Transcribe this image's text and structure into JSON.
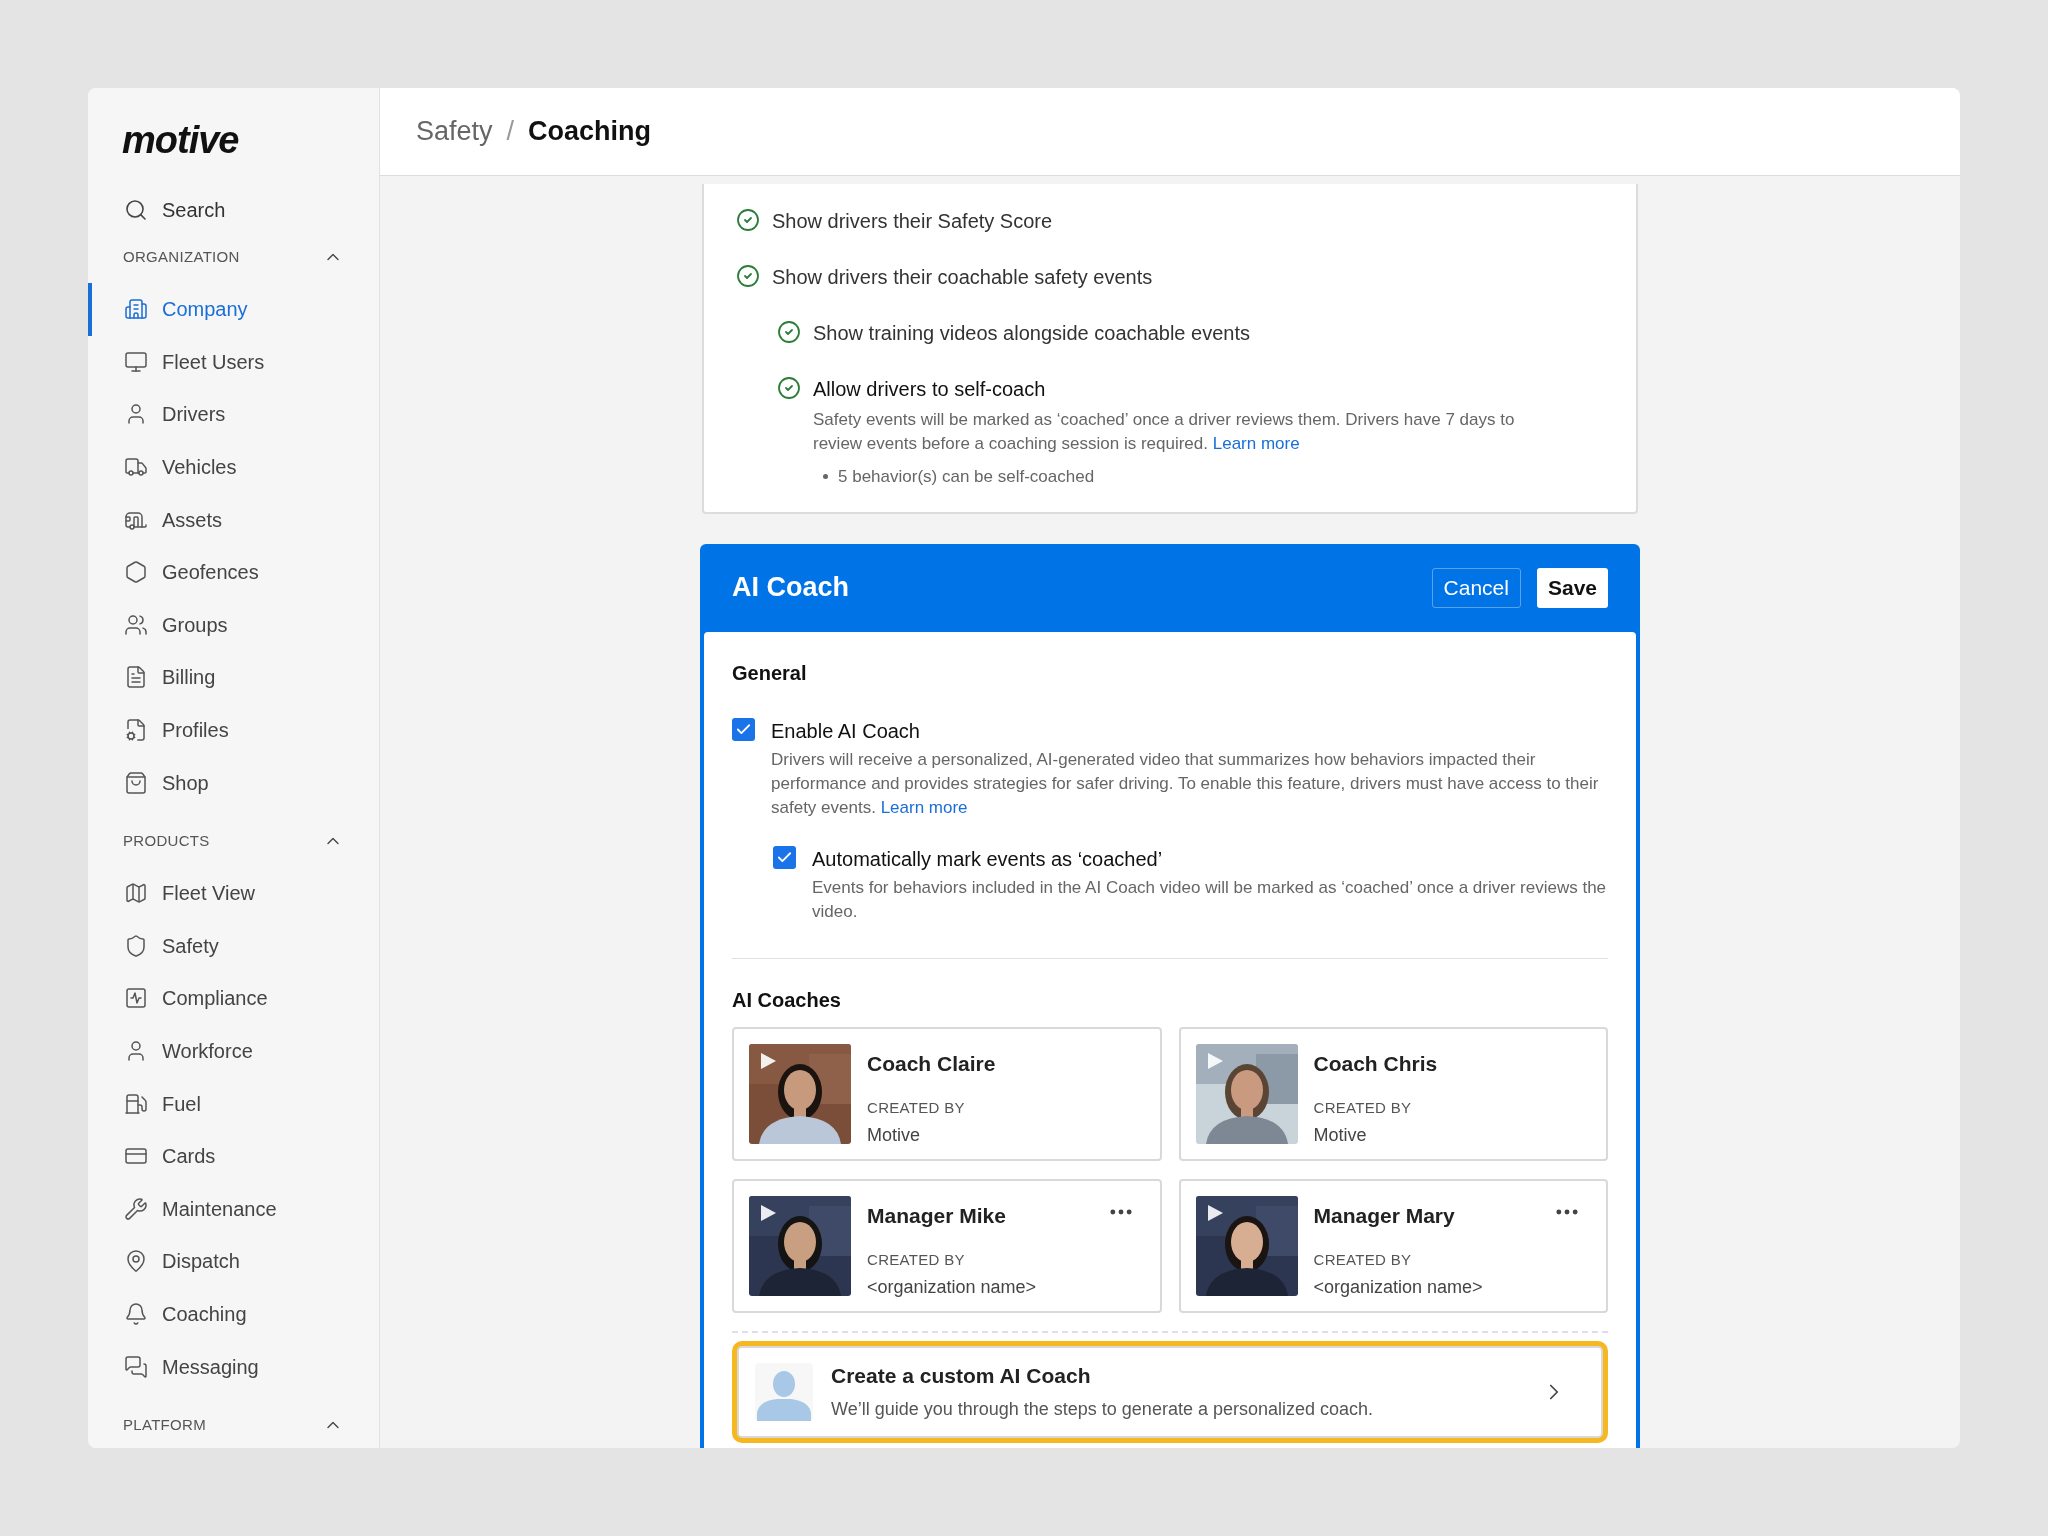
{
  "sidebar": {
    "logo": "motive",
    "search": "Search",
    "sections": [
      {
        "label": "ORGANIZATION",
        "expanded": true,
        "items": [
          {
            "label": "Company",
            "selected": true
          },
          {
            "label": "Fleet Users",
            "selected": false
          },
          {
            "label": "Drivers",
            "selected": false
          },
          {
            "label": "Vehicles",
            "selected": false
          },
          {
            "label": "Assets",
            "selected": false
          },
          {
            "label": "Geofences",
            "selected": false
          },
          {
            "label": "Groups",
            "selected": false
          },
          {
            "label": "Billing",
            "selected": false
          },
          {
            "label": "Profiles",
            "selected": false
          },
          {
            "label": "Shop",
            "selected": false
          }
        ]
      },
      {
        "label": "PRODUCTS",
        "expanded": true,
        "items": [
          {
            "label": "Fleet View",
            "selected": false
          },
          {
            "label": "Safety",
            "selected": false
          },
          {
            "label": "Compliance",
            "selected": false
          },
          {
            "label": "Workforce",
            "selected": false
          },
          {
            "label": "Fuel",
            "selected": false
          },
          {
            "label": "Cards",
            "selected": false
          },
          {
            "label": "Maintenance",
            "selected": false
          },
          {
            "label": "Dispatch",
            "selected": false
          },
          {
            "label": "Coaching",
            "selected": false
          },
          {
            "label": "Messaging",
            "selected": false
          }
        ]
      },
      {
        "label": "PLATFORM",
        "expanded": true
      }
    ]
  },
  "breadcrumb_separator": "/",
  "breadcrumb": [
    {
      "label": "Safety",
      "current": false
    },
    {
      "label": "Coaching",
      "current": true
    }
  ],
  "settings_card": {
    "items": [
      {
        "label": "Show drivers their Safety Score",
        "checked": true
      },
      {
        "label": "Show drivers their coachable safety events",
        "checked": true,
        "children": [
          {
            "label": "Show training videos alongside coachable events",
            "checked": true
          },
          {
            "label": "Allow drivers to self-coach",
            "checked": true,
            "description": "Safety events will be marked as ‘coached’ once a driver reviews them. Drivers have 7 days to review events before a coaching session is required. ",
            "link": "Learn more",
            "bullets": [
              "5 behavior(s) can be self-coached"
            ]
          }
        ]
      }
    ]
  },
  "ai_coach": {
    "title": "AI Coach",
    "buttons": [
      {
        "label": "Cancel",
        "kind": "secondary"
      },
      {
        "label": "Save",
        "kind": "primary"
      }
    ],
    "general": {
      "heading": "General",
      "options": [
        {
          "label": "Enable AI Coach",
          "checked": true,
          "description": "Drivers will receive a personalized, AI-generated video that summarizes how behaviors impacted their performance and provides strategies for safer driving. To enable this feature, drivers must have access to their safety events. ",
          "link": "Learn more",
          "children": [
            {
              "label": "Automatically mark events as ‘coached’",
              "checked": true,
              "description": "Events for behaviors included in the AI Coach video will be marked as ‘coached’ once a driver reviews the video."
            }
          ]
        }
      ]
    },
    "coaches": {
      "heading": "AI Coaches",
      "items": [
        {
          "name": "Coach Claire",
          "created_label": "CREATED BY",
          "creator": "Motive",
          "menu": false
        },
        {
          "name": "Coach Chris",
          "created_label": "CREATED BY",
          "creator": "Motive",
          "menu": false
        },
        {
          "name": "Manager Mike",
          "created_label": "CREATED BY",
          "creator": "<organization name>",
          "menu": true
        },
        {
          "name": "Manager Mary",
          "created_label": "CREATED BY",
          "creator": "<organization name>",
          "menu": true
        }
      ]
    },
    "custom": {
      "title": "Create a custom AI Coach",
      "subtitle": "We’ll guide you through the steps to generate a personalized coach.",
      "highlighted": true
    }
  }
}
